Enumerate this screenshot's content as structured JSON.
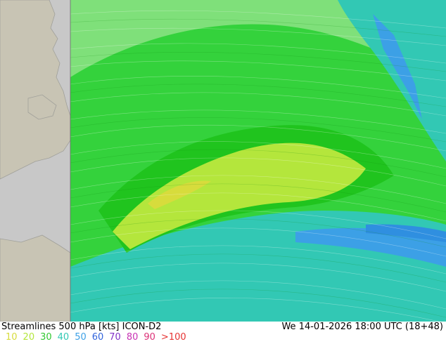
{
  "title": "Streamlines 500 hPa [kts] ICON-D2",
  "datetime": "We 14-01-2026 18:00 UTC (18+48)",
  "legend": [
    {
      "label": "10",
      "color": "#d7dc3c"
    },
    {
      "label": "20",
      "color": "#b4e63c"
    },
    {
      "label": "30",
      "color": "#32c832"
    },
    {
      "label": "40",
      "color": "#32c8b4"
    },
    {
      "label": "50",
      "color": "#3ca0e6"
    },
    {
      "label": "60",
      "color": "#3264dc"
    },
    {
      "label": "70",
      "color": "#8232c8"
    },
    {
      "label": "80",
      "color": "#c832b4"
    },
    {
      "label": "90",
      "color": "#dc3278"
    },
    {
      "label": ">100",
      "color": "#e63232"
    }
  ],
  "colors": {
    "land": "#c4c2b4",
    "sea_outside": "#cccccc",
    "field_main": "#34d23c",
    "field_light": "#9be85c",
    "field_yellow": "#c8ec3c",
    "field_cyan": "#32c8b4",
    "field_blue": "#3ca0e6"
  }
}
